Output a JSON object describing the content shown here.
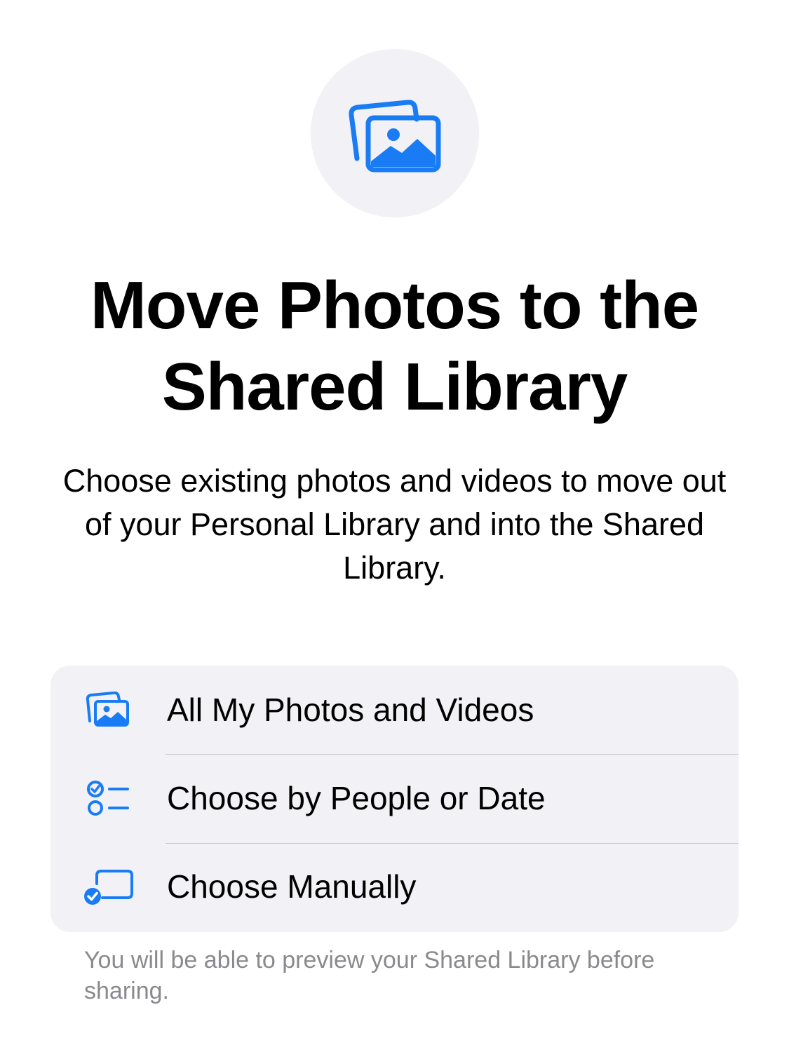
{
  "accent_color": "#1a7cf5",
  "hero": {
    "icon": "photo-stack-icon"
  },
  "title": "Move Photos to the Shared Library",
  "subtitle": "Choose existing photos and videos to move out of your Personal Library and into the Shared Library.",
  "options": [
    {
      "icon": "photo-stack-icon",
      "label": "All My Photos and Videos"
    },
    {
      "icon": "checklist-icon",
      "label": "Choose by People or Date"
    },
    {
      "icon": "select-manually-icon",
      "label": "Choose Manually"
    }
  ],
  "footnote": "You will be able to preview your Shared Library before sharing."
}
